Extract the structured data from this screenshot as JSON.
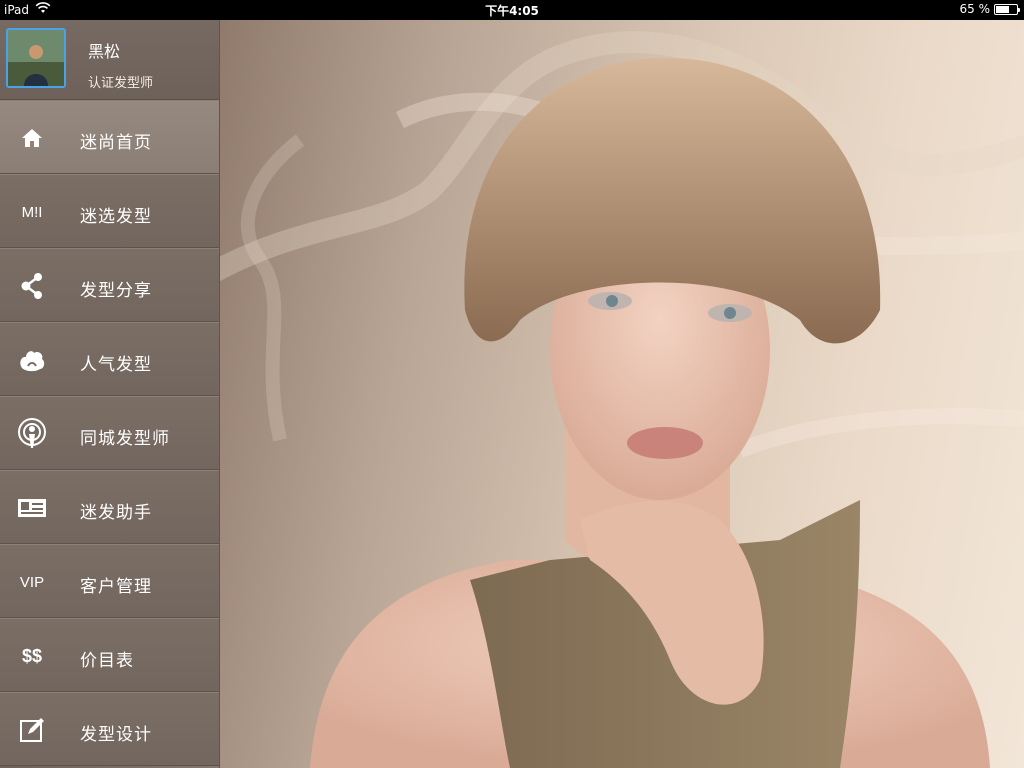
{
  "status_bar": {
    "device": "iPad",
    "time": "下午4:05",
    "battery": "65 %",
    "battery_level": 0.65
  },
  "profile": {
    "name": "黑松",
    "title": "认证发型师"
  },
  "menu": {
    "items": [
      {
        "label": "迷尚首页",
        "icon": "home-icon",
        "active": true
      },
      {
        "label": "迷选发型",
        "icon": "mi-logo-icon",
        "icon_text": "M!I"
      },
      {
        "label": "发型分享",
        "icon": "share-icon"
      },
      {
        "label": "人气发型",
        "icon": "flame-icon"
      },
      {
        "label": "同城发型师",
        "icon": "location-icon"
      },
      {
        "label": "迷发助手",
        "icon": "id-card-icon"
      },
      {
        "label": "客户管理",
        "icon": "vip-icon",
        "icon_text": "VIP"
      },
      {
        "label": "价目表",
        "icon": "price-icon",
        "icon_text": "$$"
      },
      {
        "label": "发型设计",
        "icon": "edit-icon"
      }
    ]
  },
  "colors": {
    "avatar_border": "#4aa3e8",
    "sidebar": "#75685f",
    "background_light": "#f2e6d8"
  }
}
